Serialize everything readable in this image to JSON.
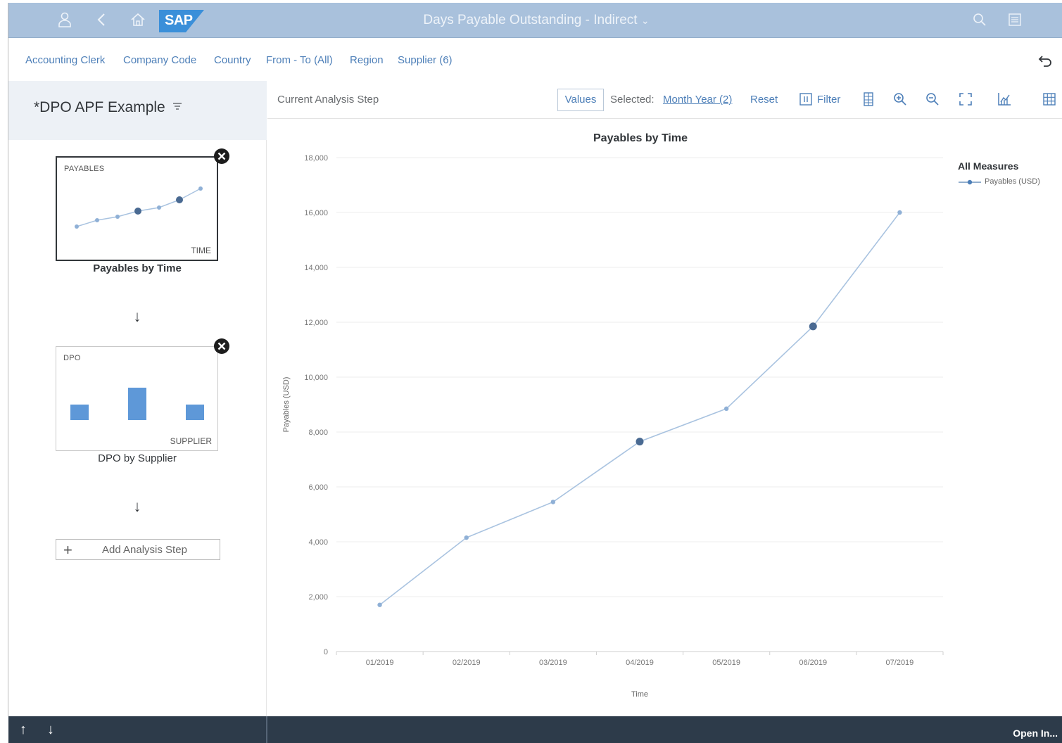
{
  "shell": {
    "title": "Days Payable Outstanding - Indirect",
    "logo": "SAP",
    "icons": [
      "user-icon",
      "back-icon",
      "home-icon",
      "search-icon",
      "menu-icon"
    ]
  },
  "filters": {
    "items": [
      "Accounting Clerk",
      "Company Code",
      "Country",
      "From - To (All)",
      "Region",
      "Supplier (6)"
    ]
  },
  "left": {
    "title": "*DPO APF Example",
    "steps": [
      {
        "title": "Payables by Time",
        "ylabel": "PAYABLES",
        "xlabel": "TIME"
      },
      {
        "title": "DPO by Supplier",
        "ylabel": "DPO",
        "xlabel": "SUPPLIER"
      }
    ],
    "add_step": "Add Analysis Step"
  },
  "toolbar": {
    "label": "Current Analysis Step",
    "values": "Values",
    "selected_label": "Selected:",
    "selected_link": "Month Year (2)",
    "reset": "Reset",
    "filter": "Filter"
  },
  "footer": {
    "open_in": "Open In..."
  },
  "colors": {
    "line": "#a9c3e0",
    "point": "#8fb0d6",
    "selected_point": "#4a6a92",
    "shell": "#a9c1dc",
    "footer": "#2d3b4a"
  },
  "chart_data": {
    "type": "line",
    "title": "Payables by Time",
    "xlabel": "Time",
    "ylabel": "Payables (USD)",
    "categories": [
      "01/2019",
      "02/2019",
      "03/2019",
      "04/2019",
      "05/2019",
      "06/2019",
      "07/2019"
    ],
    "series": [
      {
        "name": "Payables (USD)",
        "values": [
          1700,
          4150,
          5450,
          7650,
          8850,
          11850,
          16000
        ]
      }
    ],
    "selected_categories": [
      "04/2019",
      "06/2019"
    ],
    "yticks": [
      "0",
      "2,000",
      "4,000",
      "6,000",
      "8,000",
      "10,000",
      "12,000",
      "14,000",
      "16,000",
      "18,000"
    ],
    "ylim": [
      0,
      18000
    ],
    "legend_title": "All Measures",
    "legend_position": "top-right",
    "grid": true
  }
}
